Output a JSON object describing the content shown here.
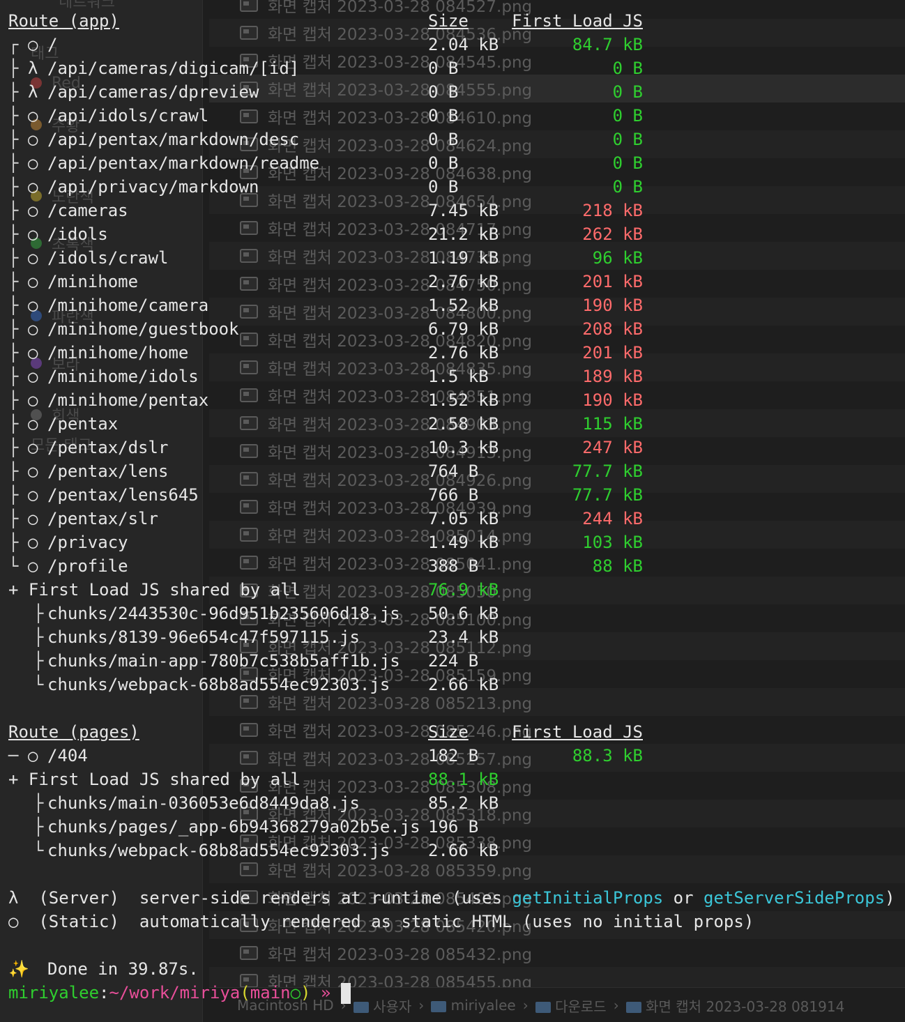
{
  "finder": {
    "files": [
      "화면 캡처 2023-03-28 084527.png",
      "화면 캡처 2023-03-28 084536.png",
      "화면 캡처 2023-03-28 084545.png",
      "화면 캡처 2023-03-28 084555.png",
      "화면 캡처 2023-03-28 084610.png",
      "화면 캡처 2023-03-28 084624.png",
      "화면 캡처 2023-03-28 084638.png",
      "화면 캡처 2023-03-28 084654.png",
      "화면 캡처 2023-03-28 084717.png",
      "화면 캡처 2023-03-28 084735.png",
      "화면 캡처 2023-03-28 084750.png",
      "화면 캡처 2023-03-28 084800.png",
      "화면 캡처 2023-03-28 084820.png",
      "화면 캡처 2023-03-28 084835.png",
      "화면 캡처 2023-03-28 084851.png",
      "화면 캡처 2023-03-28 084903.png",
      "화면 캡처 2023-03-28 084913.png",
      "화면 캡처 2023-03-28 084926.png",
      "화면 캡처 2023-03-28 084939.png",
      "화면 캡처 2023-03-28 085014.png",
      "화면 캡처 2023-03-28 085041.png",
      "화면 캡처 2023-03-28 085050.png",
      "화면 캡처 2023-03-28 085100.png",
      "화면 캡처 2023-03-28 085112.png",
      "화면 캡처 2023-03-28 085159.png",
      "화면 캡처 2023-03-28 085213.png",
      "화면 캡처 2023-03-28 085246.png",
      "화면 캡처 2023-03-28 085257.png",
      "화면 캡처 2023-03-28 085308.png",
      "화면 캡처 2023-03-28 085318.png",
      "화면 캡처 2023-03-28 085338.png",
      "화면 캡처 2023-03-28 085359.png",
      "화면 캡처 2023-03-28 085409.png",
      "화면 캡처 2023-03-28 085420.png",
      "화면 캡처 2023-03-28 085432.png",
      "화면 캡처 2023-03-28 085455.png"
    ],
    "sidebar_items": [
      "네트워크",
      "태그",
      "Red",
      "주황",
      "노란색",
      "초록색",
      "파란색",
      "보라",
      "회색",
      "모든 태그"
    ],
    "pathbar": [
      "Macintosh HD",
      "사용자",
      "miriyalee",
      "다운로드",
      "화면 캡처 2023-03-28 081914"
    ]
  },
  "app_table": {
    "header": {
      "route": "Route (app)",
      "size": "Size",
      "first_load": "First Load JS"
    },
    "rows": [
      {
        "tree": "┌",
        "sym": "○",
        "path": "/",
        "size": "2.04 kB",
        "load": "84.7 kB",
        "status": "green"
      },
      {
        "tree": "├",
        "sym": "λ",
        "path": "/api/cameras/digicam/[id]",
        "size": "0 B",
        "load": "0 B",
        "status": "green"
      },
      {
        "tree": "├",
        "sym": "λ",
        "path": "/api/cameras/dpreview",
        "size": "0 B",
        "load": "0 B",
        "status": "green"
      },
      {
        "tree": "├",
        "sym": "○",
        "path": "/api/idols/crawl",
        "size": "0 B",
        "load": "0 B",
        "status": "green"
      },
      {
        "tree": "├",
        "sym": "○",
        "path": "/api/pentax/markdown/desc",
        "size": "0 B",
        "load": "0 B",
        "status": "green"
      },
      {
        "tree": "├",
        "sym": "○",
        "path": "/api/pentax/markdown/readme",
        "size": "0 B",
        "load": "0 B",
        "status": "green"
      },
      {
        "tree": "├",
        "sym": "○",
        "path": "/api/privacy/markdown",
        "size": "0 B",
        "load": "0 B",
        "status": "green"
      },
      {
        "tree": "├",
        "sym": "○",
        "path": "/cameras",
        "size": "7.45 kB",
        "load": "218 kB",
        "status": "red"
      },
      {
        "tree": "├",
        "sym": "○",
        "path": "/idols",
        "size": "21.2 kB",
        "load": "262 kB",
        "status": "red"
      },
      {
        "tree": "├",
        "sym": "○",
        "path": "/idols/crawl",
        "size": "1.19 kB",
        "load": "96 kB",
        "status": "green"
      },
      {
        "tree": "├",
        "sym": "○",
        "path": "/minihome",
        "size": "2.76 kB",
        "load": "201 kB",
        "status": "red"
      },
      {
        "tree": "├",
        "sym": "○",
        "path": "/minihome/camera",
        "size": "1.52 kB",
        "load": "190 kB",
        "status": "red"
      },
      {
        "tree": "├",
        "sym": "○",
        "path": "/minihome/guestbook",
        "size": "6.79 kB",
        "load": "208 kB",
        "status": "red"
      },
      {
        "tree": "├",
        "sym": "○",
        "path": "/minihome/home",
        "size": "2.76 kB",
        "load": "201 kB",
        "status": "red"
      },
      {
        "tree": "├",
        "sym": "○",
        "path": "/minihome/idols",
        "size": "1.5 kB",
        "load": "189 kB",
        "status": "red"
      },
      {
        "tree": "├",
        "sym": "○",
        "path": "/minihome/pentax",
        "size": "1.52 kB",
        "load": "190 kB",
        "status": "red"
      },
      {
        "tree": "├",
        "sym": "○",
        "path": "/pentax",
        "size": "2.58 kB",
        "load": "115 kB",
        "status": "green"
      },
      {
        "tree": "├",
        "sym": "○",
        "path": "/pentax/dslr",
        "size": "10.3 kB",
        "load": "247 kB",
        "status": "red"
      },
      {
        "tree": "├",
        "sym": "○",
        "path": "/pentax/lens",
        "size": "764 B",
        "load": "77.7 kB",
        "status": "green"
      },
      {
        "tree": "├",
        "sym": "○",
        "path": "/pentax/lens645",
        "size": "766 B",
        "load": "77.7 kB",
        "status": "green"
      },
      {
        "tree": "├",
        "sym": "○",
        "path": "/pentax/slr",
        "size": "7.05 kB",
        "load": "244 kB",
        "status": "red"
      },
      {
        "tree": "├",
        "sym": "○",
        "path": "/privacy",
        "size": "1.49 kB",
        "load": "103 kB",
        "status": "green"
      },
      {
        "tree": "└",
        "sym": "○",
        "path": "/profile",
        "size": "388 B",
        "load": "88 kB",
        "status": "green"
      }
    ],
    "shared": {
      "label": "+ First Load JS shared by all",
      "size": "76.9 kB"
    },
    "chunks": [
      {
        "tree": "├",
        "name": "chunks/2443530c-96d951b235606d18.js",
        "size": "50.6 kB"
      },
      {
        "tree": "├",
        "name": "chunks/8139-96e654c47f597115.js",
        "size": "23.4 kB"
      },
      {
        "tree": "├",
        "name": "chunks/main-app-780b7c538b5aff1b.js",
        "size": "224 B"
      },
      {
        "tree": "└",
        "name": "chunks/webpack-68b8ad554ec92303.js",
        "size": "2.66 kB"
      }
    ]
  },
  "pages_table": {
    "header": {
      "route": "Route (pages)",
      "size": "Size",
      "first_load": "First Load JS"
    },
    "rows": [
      {
        "tree": "─",
        "sym": "○",
        "path": "/404",
        "size": "182 B",
        "load": "88.3 kB",
        "status": "green"
      }
    ],
    "shared": {
      "label": "+ First Load JS shared by all",
      "size": "88.1 kB"
    },
    "chunks": [
      {
        "tree": "├",
        "name": "chunks/main-036053e6d8449da8.js",
        "size": "85.2 kB"
      },
      {
        "tree": "├",
        "name": "chunks/pages/_app-6b94368279a02b5e.js",
        "size": "196 B"
      },
      {
        "tree": "└",
        "name": "chunks/webpack-68b8ad554ec92303.js",
        "size": "2.66 kB"
      }
    ]
  },
  "legend": {
    "server": {
      "sym": "λ",
      "kind": "(Server)",
      "desc_a": "server-side renders at runtime (uses ",
      "api1": "getInitialProps",
      "mid": " or ",
      "api2": "getServerSideProps",
      "end": ")"
    },
    "static": {
      "sym": "○",
      "kind": "(Static)",
      "desc": "automatically rendered as static HTML (uses no initial props)"
    }
  },
  "done": {
    "icon": "sparkles-icon",
    "glyph": "✨",
    "text": "Done in 39.87s."
  },
  "prompt": {
    "user": "miriyalee",
    "sep": ":",
    "path": "~/work/miriya",
    "branch_open": "(",
    "branch": "main",
    "dirty": "○",
    "branch_close": ")",
    "arrow": "»"
  },
  "colors": {
    "green": "#2fcf2f",
    "red": "#ff6b6b",
    "cyan": "#3bc6d8",
    "text": "#e6e6e6"
  }
}
